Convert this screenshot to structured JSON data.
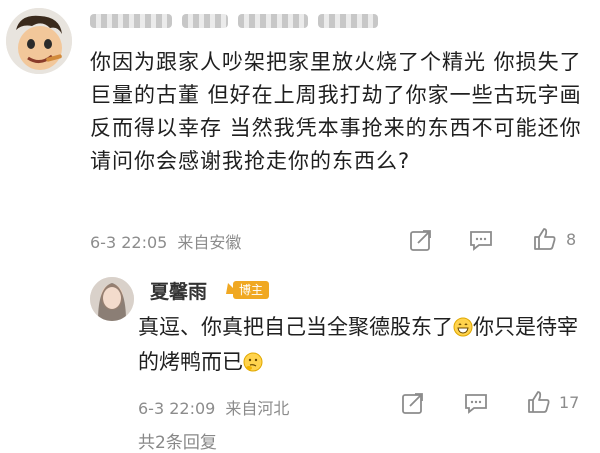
{
  "comment1": {
    "text": "你因为跟家人吵架把家里放火烧了个精光 你损失了巨量的古董 但好在上周我打劫了你家一些古玩字画反而得以幸存 当然我凭本事抢来的东西不可能还你 请问你会感谢我抢走你的东西么?",
    "date": "6-3 22:05",
    "location": "来自安徽",
    "likes": "8"
  },
  "comment2": {
    "username": "夏馨雨",
    "badge": "博主",
    "text_part1": "真逗、你真把自己当全聚德股东了",
    "text_part2": "你只是待宰的烤鸭而已",
    "date": "6-3 22:09",
    "location": "来自河北",
    "likes": "17"
  },
  "footer": {
    "replies_text": "共2条回复"
  },
  "colors": {
    "meta_gray": "#8c8c8c",
    "badge_orange": "#f0a822",
    "text_dark": "#1f1f1f"
  }
}
